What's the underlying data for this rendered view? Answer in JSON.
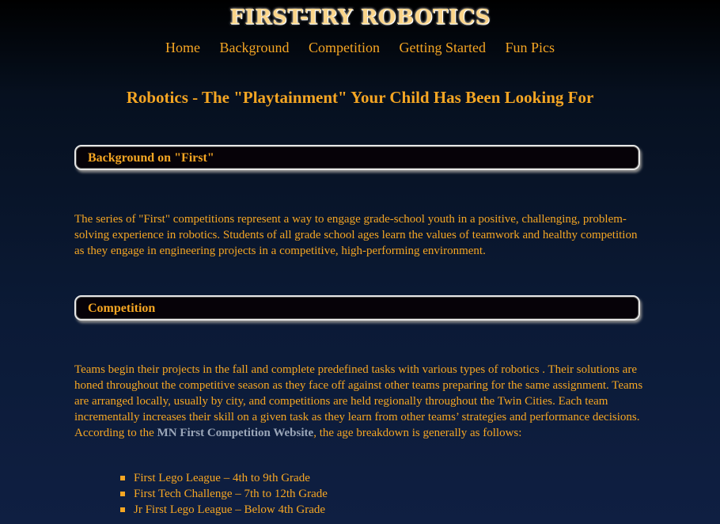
{
  "site": {
    "title": "FIRST-TRY ROBOTICS"
  },
  "nav": {
    "items": [
      {
        "label": "Home"
      },
      {
        "label": "Background"
      },
      {
        "label": "Competition"
      },
      {
        "label": "Getting Started"
      },
      {
        "label": "Fun Pics"
      }
    ]
  },
  "tagline": "Robotics - The \"Playtainment\" Your Child Has Been Looking For",
  "sections": [
    {
      "heading": "Background on \"First\"",
      "body": "The series of \"First\" competitions represent a way to engage grade-school youth in a positive, challenging, problem-solving experience in robotics. Students of all grade school ages learn the values of teamwork and healthy competition as they engage in engineering projects in a competitive, high-performing environment."
    },
    {
      "heading": "Competition",
      "body_before_link": "Teams begin their projects in the fall and complete predefined tasks with various types of robotics . Their solutions are honed throughout the competitive season as they face off against other teams preparing for the same assignment. Teams are arranged locally, usually by city, and competitions are held regionally throughout the Twin Cities. Each team incrementally increases their skill on a given task as they learn from other teams’ strategies and performance decisions. According to the ",
      "link_text": "MN First Competition Website",
      "body_after_link": ", the age breakdown is generally as follows:",
      "list": [
        "First Lego League – 4th to 9th Grade",
        "First Tech Challenge – 7th to 12th Grade",
        "Jr First Lego League – Below 4th Grade"
      ]
    }
  ],
  "colors": {
    "text": "#f5a623",
    "title": "#fbd58a",
    "link": "#9aa6b8",
    "header_box": "#060208",
    "background_top": "#000000",
    "background_bottom": "#0f1f42"
  }
}
